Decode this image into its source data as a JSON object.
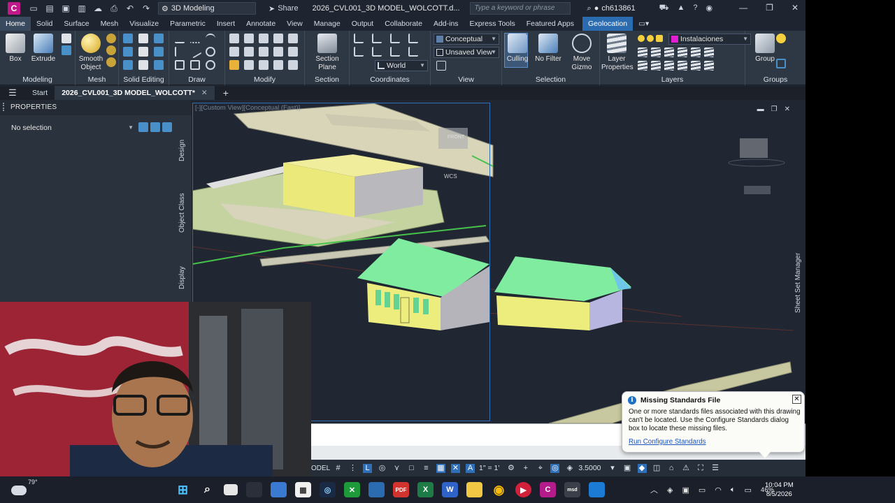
{
  "titlebar": {
    "app_letter": "C",
    "workspace": "3D Modeling",
    "share_label": "Share",
    "doc_title": "2026_CVL001_3D MODEL_WOLCOTT.d...",
    "search_placeholder": "Type a keyword or phrase",
    "username": "ch613861"
  },
  "ribbon_tabs": [
    "Home",
    "Solid",
    "Surface",
    "Mesh",
    "Visualize",
    "Parametric",
    "Insert",
    "Annotate",
    "View",
    "Manage",
    "Output",
    "Collaborate",
    "Add-ins",
    "Express Tools",
    "Featured Apps",
    "Geolocation"
  ],
  "ribbon": {
    "panels": {
      "modeling": "Modeling",
      "mesh": "Mesh",
      "solid_editing": "Solid Editing",
      "draw": "Draw",
      "modify": "Modify",
      "section": "Section",
      "coordinates": "Coordinates",
      "view": "View",
      "selection": "Selection",
      "layers": "Layers",
      "groups": "Groups"
    },
    "buttons": {
      "box": "Box",
      "extrude": "Extrude",
      "smooth_object": "Smooth Object",
      "section_plane": "Section Plane",
      "culling": "Culling",
      "no_filter": "No Filter",
      "move_gizmo": "Move Gizmo",
      "layer_properties": "Layer Properties",
      "group": "Group"
    },
    "dropdowns": {
      "visual_style": "Conceptual",
      "view": "Unsaved View",
      "ucs": "World",
      "layer": "Instalaciones"
    },
    "colors": {
      "layer_swatch": "#e020d0",
      "culling_active": "#3c5778",
      "geolocation_tab": "#2b6cb0"
    }
  },
  "file_tabs": {
    "start": "Start",
    "active": "2026_CVL001_3D MODEL_WOLCOTT*"
  },
  "properties": {
    "title": "PROPERTIES",
    "selection": "No selection",
    "side_tabs": [
      "Design",
      "Object Class",
      "Display"
    ]
  },
  "viewport": {
    "label": "[-][Custom View][Conceptual (Fast)]",
    "viewcube_face": "FRONT",
    "wcs_label": "WCS",
    "sheet_set_manager": "Sheet Set Manager"
  },
  "statusbar": {
    "model": "ODEL",
    "annotation_scale": "1\" = 1'",
    "zoom_value": "3.5000"
  },
  "notification": {
    "title": "Missing Standards File",
    "body": "One or more standards files associated with this drawing can't be located. Use the Configure Standards dialog box to locate these missing files.",
    "link": "Run Configure Standards"
  },
  "taskbar": {
    "weather_temp": "79°",
    "battery": "46%",
    "time": "10:04 PM",
    "date": "8/5/2026"
  }
}
